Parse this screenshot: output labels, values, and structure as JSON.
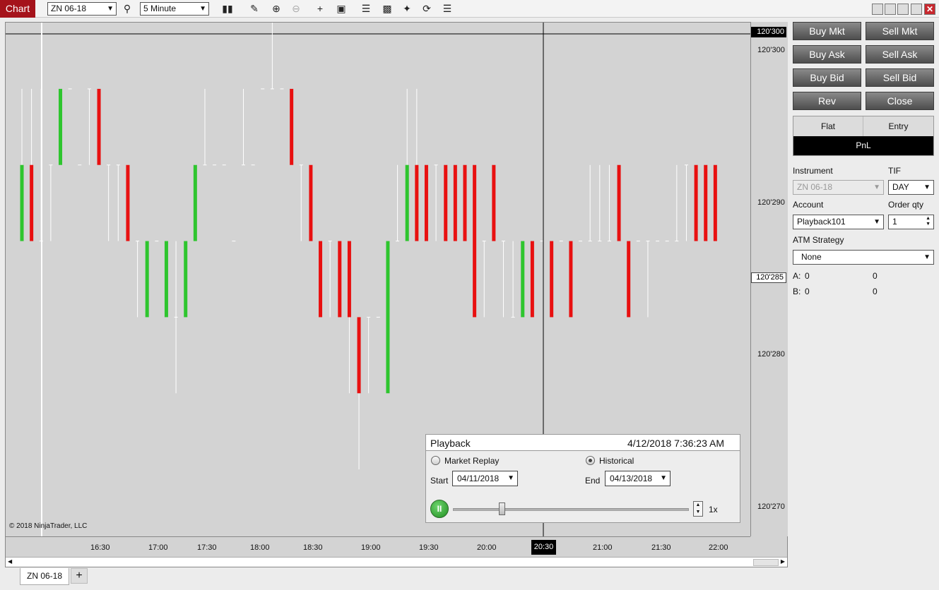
{
  "toolbar": {
    "chart_tab": "Chart",
    "instrument": "ZN 06-18",
    "interval": "5 Minute",
    "icons": [
      "search-icon",
      "bar-type-icon",
      "draw-icon",
      "zoom-in-icon",
      "zoom-out-icon",
      "crosshair-icon",
      "data-box-icon",
      "indicators-icon",
      "strategies-icon",
      "hot-list-icon",
      "refresh-icon",
      "properties-icon"
    ]
  },
  "chart": {
    "price_tag_top": "120'300",
    "price_tag_current": "120'285",
    "price_labels": [
      "120'300",
      "120'290",
      "120'280",
      "120'270"
    ],
    "time_labels": [
      "16:30",
      "17:00",
      "17:30",
      "18:00",
      "18:30",
      "19:00",
      "19:30",
      "20:00",
      "21:00",
      "21:30",
      "22:00"
    ],
    "time_highlight": "20:30",
    "copyright": "© 2018 NinjaTrader, LLC",
    "up_color": "#2ec52e",
    "down_color": "#e81010",
    "wick_color": "#ffffff",
    "bars": [
      {
        "o": 120.2875,
        "h": 120.2975,
        "l": 120.2875,
        "c": 120.2925,
        "dir": "up"
      },
      {
        "o": 120.2925,
        "h": 120.2975,
        "l": 120.2875,
        "c": 120.2875,
        "dir": "down"
      },
      {
        "o": 120.2875,
        "h": 120.2975,
        "l": 120.2875,
        "c": 120.2875,
        "dir": "flat"
      },
      {
        "o": 120.2925,
        "h": 120.2925,
        "l": 120.2875,
        "c": 120.2925,
        "dir": "flat"
      },
      {
        "o": 120.2925,
        "h": 120.2975,
        "l": 120.2925,
        "c": 120.2975,
        "dir": "up"
      },
      {
        "o": 120.2975,
        "h": 120.2975,
        "l": 120.2975,
        "c": 120.2975,
        "dir": "flat"
      },
      {
        "o": 120.2925,
        "h": 120.2925,
        "l": 120.2925,
        "c": 120.2925,
        "dir": "flat"
      },
      {
        "o": 120.2975,
        "h": 120.2975,
        "l": 120.2925,
        "c": 120.2975,
        "dir": "flat"
      },
      {
        "o": 120.2975,
        "h": 120.2975,
        "l": 120.2925,
        "c": 120.2925,
        "dir": "down"
      },
      {
        "o": 120.2925,
        "h": 120.2925,
        "l": 120.2875,
        "c": 120.2925,
        "dir": "flat"
      },
      {
        "o": 120.2925,
        "h": 120.2925,
        "l": 120.2875,
        "c": 120.2925,
        "dir": "flat"
      },
      {
        "o": 120.2925,
        "h": 120.2925,
        "l": 120.2875,
        "c": 120.2875,
        "dir": "down"
      },
      {
        "o": 120.2875,
        "h": 120.2875,
        "l": 120.2825,
        "c": 120.2875,
        "dir": "flat"
      },
      {
        "o": 120.2825,
        "h": 120.2875,
        "l": 120.2825,
        "c": 120.2875,
        "dir": "up"
      },
      {
        "o": 120.2875,
        "h": 120.2875,
        "l": 120.2875,
        "c": 120.2875,
        "dir": "flat"
      },
      {
        "o": 120.2825,
        "h": 120.2875,
        "l": 120.2825,
        "c": 120.2875,
        "dir": "up"
      },
      {
        "o": 120.2875,
        "h": 120.2875,
        "l": 120.2775,
        "c": 120.2825,
        "dir": "flat"
      },
      {
        "o": 120.2825,
        "h": 120.2875,
        "l": 120.2825,
        "c": 120.2875,
        "dir": "up"
      },
      {
        "o": 120.2875,
        "h": 120.2925,
        "l": 120.2875,
        "c": 120.2925,
        "dir": "up"
      },
      {
        "o": 120.2925,
        "h": 120.2975,
        "l": 120.2925,
        "c": 120.2925,
        "dir": "flat"
      },
      {
        "o": 120.2925,
        "h": 120.2925,
        "l": 120.2925,
        "c": 120.2925,
        "dir": "flat"
      },
      {
        "o": 120.2925,
        "h": 120.2925,
        "l": 120.2925,
        "c": 120.2925,
        "dir": "flat"
      },
      {
        "o": 120.2875,
        "h": 120.2875,
        "l": 120.2875,
        "c": 120.2875,
        "dir": "flat"
      },
      {
        "o": 120.2925,
        "h": 120.2975,
        "l": 120.2925,
        "c": 120.2925,
        "dir": "flat"
      },
      {
        "o": 120.2925,
        "h": 120.2925,
        "l": 120.2925,
        "c": 120.2925,
        "dir": "flat"
      },
      {
        "o": 120.2975,
        "h": 120.2975,
        "l": 120.2975,
        "c": 120.2975,
        "dir": "flat"
      },
      {
        "o": 120.2975,
        "h": 120.3025,
        "l": 120.2975,
        "c": 120.2975,
        "dir": "flat"
      },
      {
        "o": 120.2975,
        "h": 120.2975,
        "l": 120.2975,
        "c": 120.2975,
        "dir": "flat"
      },
      {
        "o": 120.2975,
        "h": 120.2975,
        "l": 120.2925,
        "c": 120.2925,
        "dir": "down"
      },
      {
        "o": 120.2925,
        "h": 120.2925,
        "l": 120.2875,
        "c": 120.2925,
        "dir": "flat"
      },
      {
        "o": 120.2925,
        "h": 120.2925,
        "l": 120.2875,
        "c": 120.2875,
        "dir": "down"
      },
      {
        "o": 120.2875,
        "h": 120.2875,
        "l": 120.2825,
        "c": 120.2825,
        "dir": "down"
      },
      {
        "o": 120.2875,
        "h": 120.2875,
        "l": 120.2825,
        "c": 120.2875,
        "dir": "flat"
      },
      {
        "o": 120.2875,
        "h": 120.2875,
        "l": 120.2825,
        "c": 120.2825,
        "dir": "down"
      },
      {
        "o": 120.2875,
        "h": 120.2875,
        "l": 120.2775,
        "c": 120.2825,
        "dir": "down"
      },
      {
        "o": 120.2825,
        "h": 120.2825,
        "l": 120.2725,
        "c": 120.2775,
        "dir": "down"
      },
      {
        "o": 120.2825,
        "h": 120.2825,
        "l": 120.2775,
        "c": 120.2825,
        "dir": "flat"
      },
      {
        "o": 120.2825,
        "h": 120.2825,
        "l": 120.2825,
        "c": 120.2825,
        "dir": "flat"
      },
      {
        "o": 120.2775,
        "h": 120.2875,
        "l": 120.2775,
        "c": 120.2875,
        "dir": "up"
      },
      {
        "o": 120.2875,
        "h": 120.2925,
        "l": 120.2875,
        "c": 120.2875,
        "dir": "flat"
      },
      {
        "o": 120.2875,
        "h": 120.2975,
        "l": 120.2875,
        "c": 120.2925,
        "dir": "up"
      },
      {
        "o": 120.2925,
        "h": 120.2975,
        "l": 120.2875,
        "c": 120.2875,
        "dir": "down"
      },
      {
        "o": 120.2925,
        "h": 120.2925,
        "l": 120.2875,
        "c": 120.2875,
        "dir": "down"
      },
      {
        "o": 120.2925,
        "h": 120.2925,
        "l": 120.2875,
        "c": 120.2925,
        "dir": "flat"
      },
      {
        "o": 120.2925,
        "h": 120.2925,
        "l": 120.2875,
        "c": 120.2875,
        "dir": "down"
      },
      {
        "o": 120.2925,
        "h": 120.2925,
        "l": 120.2875,
        "c": 120.2875,
        "dir": "down"
      },
      {
        "o": 120.2925,
        "h": 120.2925,
        "l": 120.2875,
        "c": 120.2875,
        "dir": "down"
      },
      {
        "o": 120.2925,
        "h": 120.2925,
        "l": 120.2825,
        "c": 120.2825,
        "dir": "down"
      },
      {
        "o": 120.2875,
        "h": 120.2875,
        "l": 120.2825,
        "c": 120.2875,
        "dir": "flat"
      },
      {
        "o": 120.2925,
        "h": 120.2925,
        "l": 120.2875,
        "c": 120.2875,
        "dir": "down"
      },
      {
        "o": 120.2875,
        "h": 120.2875,
        "l": 120.2825,
        "c": 120.2875,
        "dir": "flat"
      },
      {
        "o": 120.2875,
        "h": 120.2875,
        "l": 120.2825,
        "c": 120.2825,
        "dir": "flat"
      },
      {
        "o": 120.2825,
        "h": 120.2875,
        "l": 120.2825,
        "c": 120.2875,
        "dir": "up"
      },
      {
        "o": 120.2875,
        "h": 120.2875,
        "l": 120.2825,
        "c": 120.2825,
        "dir": "down"
      },
      {
        "o": 120.2875,
        "h": 120.2875,
        "l": 120.2875,
        "c": 120.2875,
        "dir": "flat"
      },
      {
        "o": 120.2875,
        "h": 120.2875,
        "l": 120.2825,
        "c": 120.2825,
        "dir": "down"
      },
      {
        "o": 120.2875,
        "h": 120.2875,
        "l": 120.2875,
        "c": 120.2875,
        "dir": "flat"
      },
      {
        "o": 120.2875,
        "h": 120.2875,
        "l": 120.2825,
        "c": 120.2825,
        "dir": "down"
      },
      {
        "o": 120.2875,
        "h": 120.2875,
        "l": 120.2875,
        "c": 120.2875,
        "dir": "flat"
      },
      {
        "o": 120.2875,
        "h": 120.2925,
        "l": 120.2875,
        "c": 120.2875,
        "dir": "flat"
      },
      {
        "o": 120.2875,
        "h": 120.2925,
        "l": 120.2875,
        "c": 120.2875,
        "dir": "flat"
      },
      {
        "o": 120.2875,
        "h": 120.2925,
        "l": 120.2875,
        "c": 120.2875,
        "dir": "flat"
      },
      {
        "o": 120.2925,
        "h": 120.2925,
        "l": 120.2875,
        "c": 120.2875,
        "dir": "down"
      },
      {
        "o": 120.2875,
        "h": 120.2875,
        "l": 120.2825,
        "c": 120.2825,
        "dir": "down"
      },
      {
        "o": 120.2875,
        "h": 120.2875,
        "l": 120.2875,
        "c": 120.2875,
        "dir": "flat"
      },
      {
        "o": 120.2875,
        "h": 120.2875,
        "l": 120.2825,
        "c": 120.2875,
        "dir": "flat"
      },
      {
        "o": 120.2875,
        "h": 120.2875,
        "l": 120.2875,
        "c": 120.2875,
        "dir": "flat"
      },
      {
        "o": 120.2875,
        "h": 120.2875,
        "l": 120.2875,
        "c": 120.2875,
        "dir": "flat"
      },
      {
        "o": 120.2875,
        "h": 120.2925,
        "l": 120.2875,
        "c": 120.2875,
        "dir": "flat"
      },
      {
        "o": 120.2875,
        "h": 120.2925,
        "l": 120.2875,
        "c": 120.2925,
        "dir": "flat"
      },
      {
        "o": 120.2925,
        "h": 120.2925,
        "l": 120.2875,
        "c": 120.2875,
        "dir": "down"
      },
      {
        "o": 120.2925,
        "h": 120.2925,
        "l": 120.2875,
        "c": 120.2875,
        "dir": "down"
      },
      {
        "o": 120.2925,
        "h": 120.2925,
        "l": 120.2875,
        "c": 120.2875,
        "dir": "down"
      }
    ]
  },
  "playback": {
    "title": "Playback",
    "datetime": "4/12/2018 7:36:23 AM",
    "market_replay_label": "Market Replay",
    "historical_label": "Historical",
    "start_label": "Start",
    "start_date": "04/11/2018",
    "end_label": "End",
    "end_date": "04/13/2018",
    "pause_label": "II",
    "speed": "1x",
    "progress": 0.21
  },
  "order_panel": {
    "buttons": [
      "Buy Mkt",
      "Sell Mkt",
      "Buy Ask",
      "Sell Ask",
      "Buy Bid",
      "Sell Bid",
      "Rev",
      "Close"
    ],
    "flat_label": "Flat",
    "entry_label": "Entry",
    "pnl_label": "PnL",
    "instrument_label": "Instrument",
    "instrument_value": "ZN 06-18",
    "tif_label": "TIF",
    "tif_value": "DAY",
    "account_label": "Account",
    "account_value": "Playback101",
    "order_qty_label": "Order qty",
    "order_qty_value": "1",
    "atm_label": "ATM Strategy",
    "atm_value": "None",
    "a_label": "A:",
    "a_value1": "0",
    "a_value2": "0",
    "b_label": "B:",
    "b_value1": "0",
    "b_value2": "0"
  },
  "bottom": {
    "tab_label": "ZN 06-18",
    "add_label": "+"
  }
}
